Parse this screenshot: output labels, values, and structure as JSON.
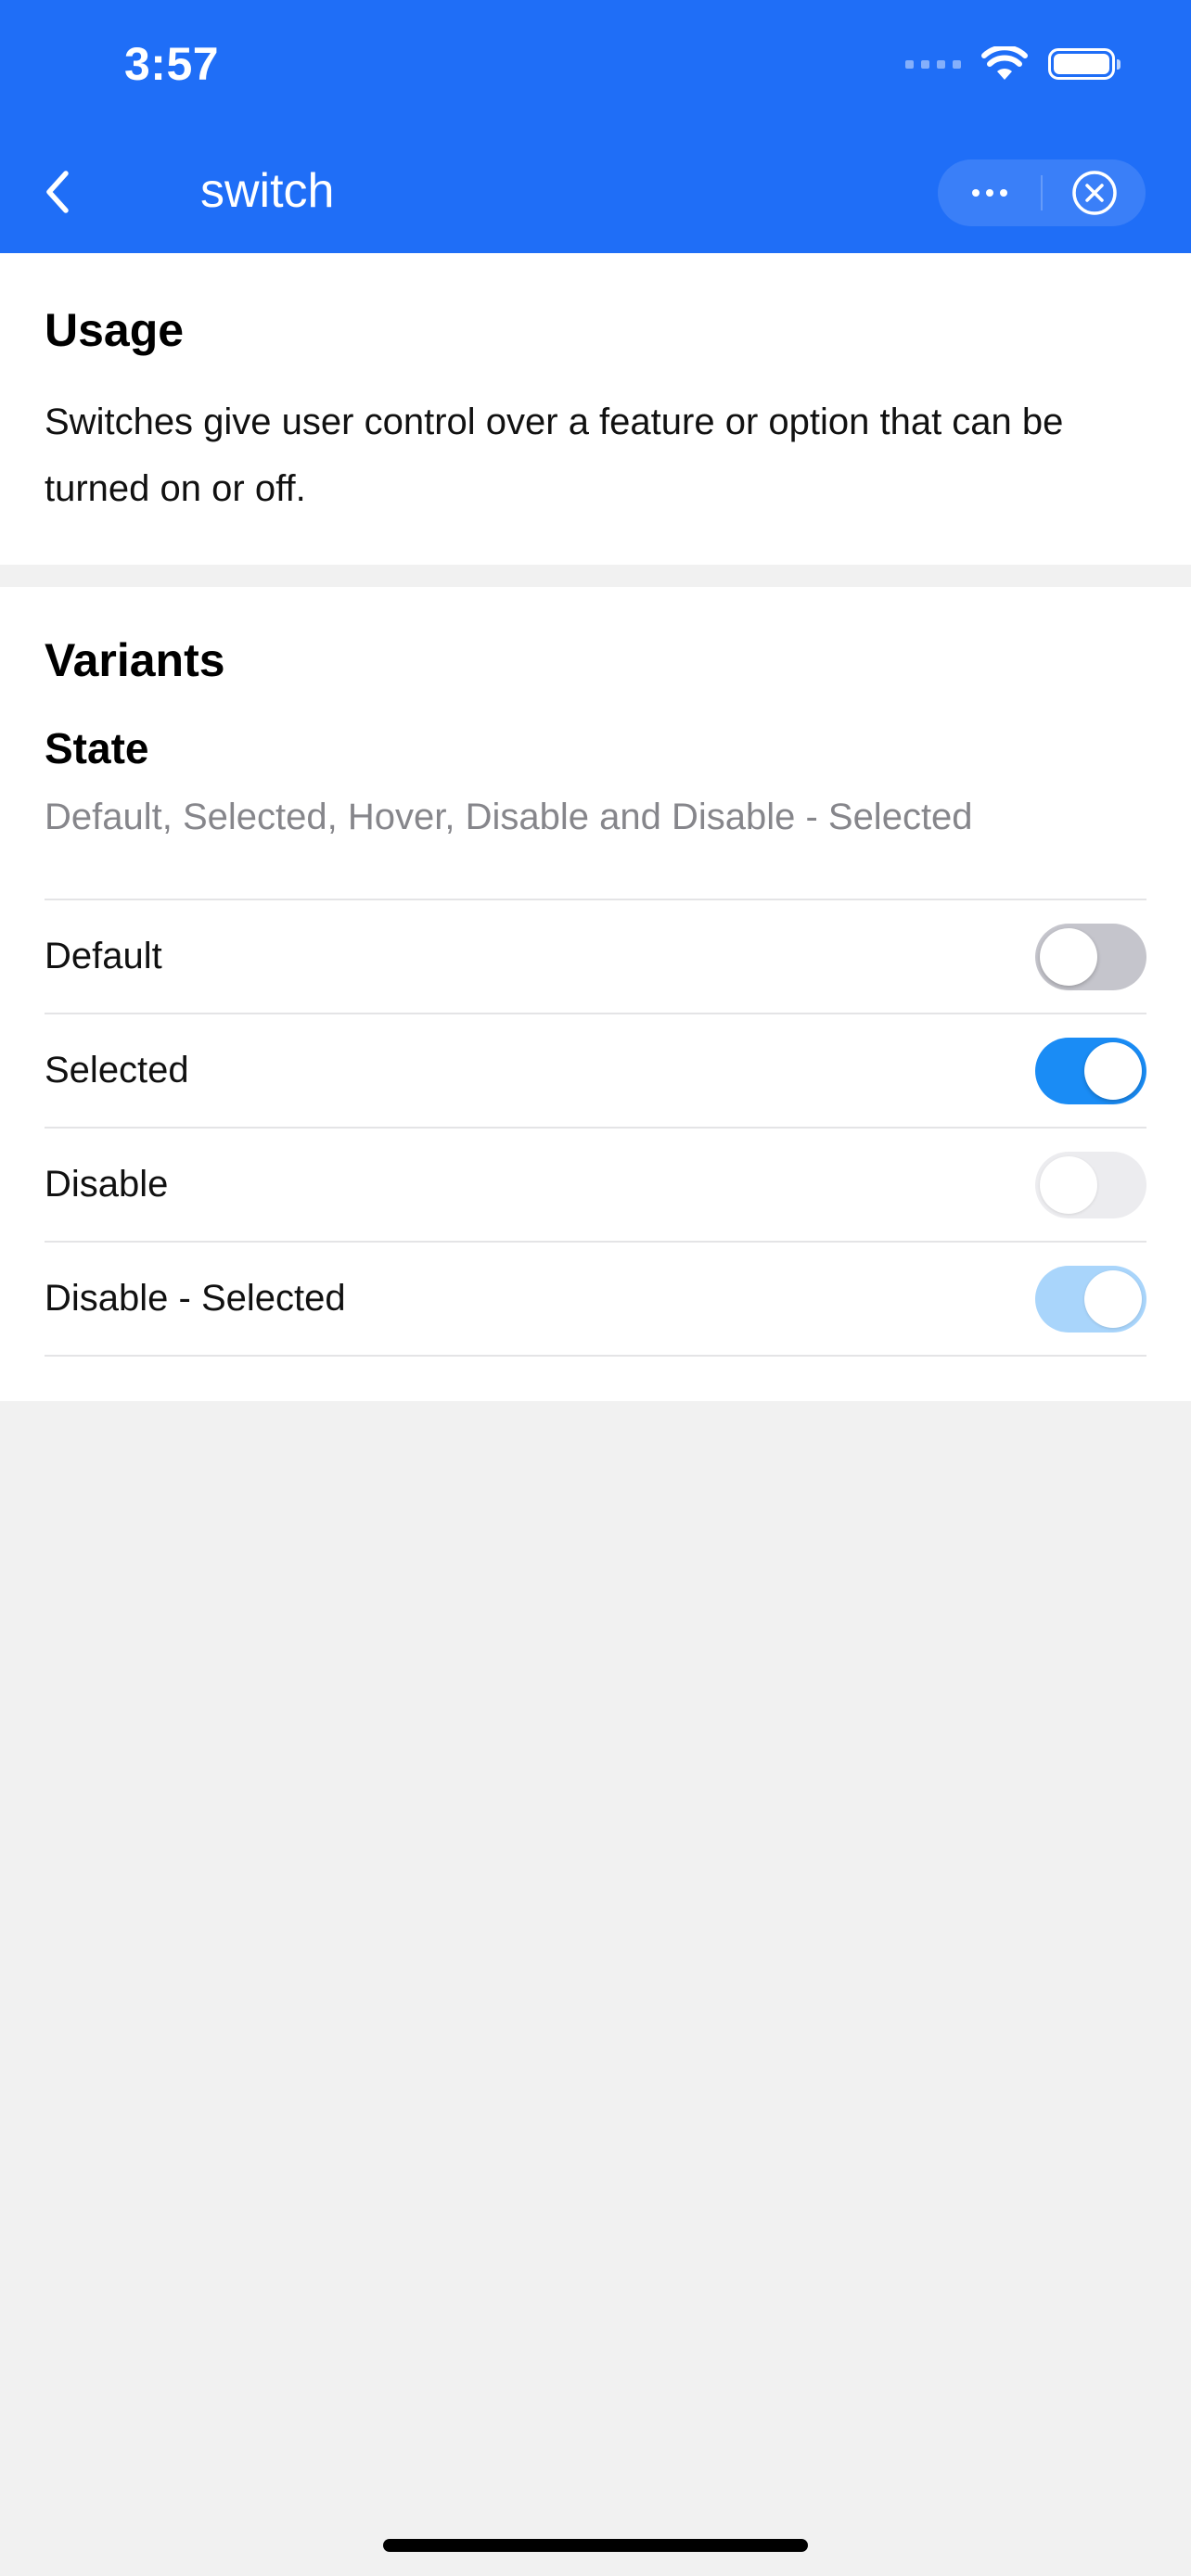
{
  "status_bar": {
    "time": "3:57",
    "icons": [
      "cellular-signal-icon",
      "wifi-icon",
      "battery-icon"
    ]
  },
  "nav_bar": {
    "title": "switch",
    "back_icon": "chevron-left-icon",
    "more_icon": "more-dots-icon",
    "close_icon": "close-circle-icon"
  },
  "usage": {
    "title": "Usage",
    "description": "Switches give user control over a feature or option that can be turned on or off."
  },
  "variants": {
    "title": "Variants",
    "state_title": "State",
    "state_description": "Default, Selected, Hover, Disable and Disable - Selected",
    "switches": [
      {
        "label": "Default",
        "checked": false,
        "disabled": false
      },
      {
        "label": "Selected",
        "checked": true,
        "disabled": false
      },
      {
        "label": "Disable",
        "checked": false,
        "disabled": true
      },
      {
        "label": "Disable - Selected",
        "checked": true,
        "disabled": true
      }
    ]
  },
  "colors": {
    "header_blue": "#1f6ef7",
    "switch_on": "#1a8cf5",
    "switch_off": "#c5c5cc",
    "switch_disabled_off": "#ececef",
    "switch_disabled_on": "#a9d5fb"
  }
}
